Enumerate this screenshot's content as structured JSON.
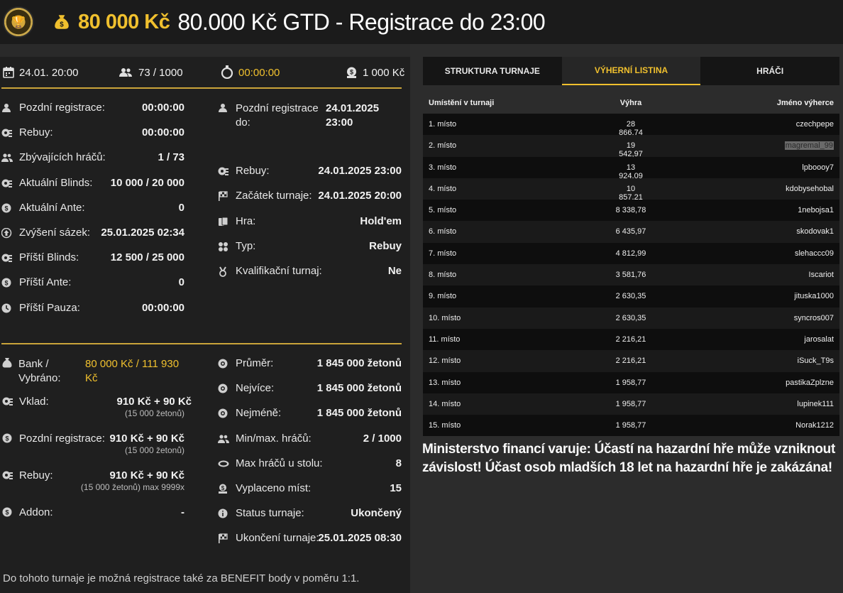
{
  "header": {
    "prize": "80 000 Kč",
    "title": "80.000 Kč GTD - Registrace do 23:00"
  },
  "left_top": {
    "date": "24.01. 20:00",
    "players": "73 / 1000",
    "timer": "00:00:00",
    "buyin": "1 000 Kč"
  },
  "info_left": [
    {
      "icon": "user-icon",
      "label": "Pozdní registrace:",
      "value": "00:00:00"
    },
    {
      "icon": "chips-icon",
      "label": "Rebuy:",
      "value": "00:00:00"
    },
    {
      "icon": "users-icon",
      "label": "Zbývajících hráčů:",
      "value": "1 / 73"
    },
    {
      "icon": "chips-icon",
      "label": "Aktuální Blinds:",
      "value": "10 000 / 20 000"
    },
    {
      "icon": "coin-icon",
      "label": "Aktuální Ante:",
      "value": "0"
    },
    {
      "icon": "arrow-up-icon",
      "label": "Zvýšení sázek:",
      "value": "25.01.2025 02:34"
    },
    {
      "icon": "chips-icon",
      "label": "Příští Blinds:",
      "value": "12 500 / 25 000"
    },
    {
      "icon": "coin-icon",
      "label": "Příští Ante:",
      "value": "0"
    },
    {
      "icon": "clock-icon",
      "label": "Příští Pauza:",
      "value": "00:00:00"
    }
  ],
  "info_right": [
    {
      "icon": "user-icon",
      "label": "Pozdní registrace do:",
      "value": "24.01.2025 23:00"
    },
    {
      "icon": "chips-icon",
      "label": "Rebuy:",
      "value": "24.01.2025 23:00"
    },
    {
      "icon": "flag-icon",
      "label": "Začátek turnaje:",
      "value": "24.01.2025 20:00"
    },
    {
      "icon": "cards-icon",
      "label": "Hra:",
      "value": "Hold'em"
    },
    {
      "icon": "suits-icon",
      "label": "Typ:",
      "value": "Rebuy"
    },
    {
      "icon": "medal-icon",
      "label": "Kvalifikační turnaj:",
      "value": "Ne"
    }
  ],
  "money_left": {
    "bank_label": "Bank / Vybráno:",
    "bank_value": "80 000 Kč / 111 930 Kč",
    "deposit_label": "Vklad:",
    "deposit_value": "910 Kč + 90 Kč",
    "deposit_sub": "(15 000 žetonů)",
    "late_label": "Pozdní registrace:",
    "late_value": "910 Kč + 90 Kč",
    "late_sub": "(15 000 žetonů)",
    "rebuy_label": "Rebuy:",
    "rebuy_value": "910 Kč + 90 Kč",
    "rebuy_sub": "(15 000 žetonů) max 9999x",
    "addon_label": "Addon:",
    "addon_value": "-"
  },
  "money_right": [
    {
      "icon": "chip-icon",
      "label": "Průměr:",
      "value": "1 845 000 žetonů"
    },
    {
      "icon": "chip-icon",
      "label": "Nejvíce:",
      "value": "1 845 000 žetonů"
    },
    {
      "icon": "chip-icon",
      "label": "Nejméně:",
      "value": "1 845 000 žetonů"
    },
    {
      "icon": "users-icon",
      "label": "Min/max. hráčů:",
      "value": "2 / 1000"
    },
    {
      "icon": "table-icon",
      "label": "Max hráčů u stolu:",
      "value": "8"
    },
    {
      "icon": "payout-icon",
      "label": "Vyplaceno míst:",
      "value": "15"
    },
    {
      "icon": "info-icon",
      "label": "Status turnaje:",
      "value": "Ukončený"
    },
    {
      "icon": "flag-icon",
      "label": "Ukončení turnaje:",
      "value": "25.01.2025 08:30"
    }
  ],
  "footer_note": "Do tohoto turnaje je možná registrace také za BENEFIT body v poměru 1:1.",
  "tabs": [
    "STRUKTURA TURNAJE",
    "VÝHERNÍ LISTINA",
    "HRÁČI"
  ],
  "payout_table": {
    "headers": [
      "Umístění v turnaji",
      "Výhra",
      "Jméno výherce"
    ],
    "rows": [
      [
        "1. místo",
        "28 866,74",
        "czechpepe"
      ],
      [
        "2. místo",
        "19 542,97",
        "magremal_99"
      ],
      [
        "3. místo",
        "13 924,09",
        "lpboooy7"
      ],
      [
        "4. místo",
        "10 857,21",
        "kdobysehobal"
      ],
      [
        "5. místo",
        "8 338,78",
        "1nebojsa1"
      ],
      [
        "6. místo",
        "6 435,97",
        "skodovak1"
      ],
      [
        "7. místo",
        "4 812,99",
        "slehaccc09"
      ],
      [
        "8. místo",
        "3 581,76",
        "Iscariot"
      ],
      [
        "9. místo",
        "2 630,35",
        "jituska1000"
      ],
      [
        "10. místo",
        "2 630,35",
        "syncros007"
      ],
      [
        "11. místo",
        "2 216,21",
        "jarosalat"
      ],
      [
        "12. místo",
        "2 216,21",
        "iSuck_T9s"
      ],
      [
        "13. místo",
        "1 958,77",
        "pastikaZplzne"
      ],
      [
        "14. místo",
        "1 958,77",
        "lupinek111"
      ],
      [
        "15. místo",
        "1 958,77",
        "Norak1212"
      ]
    ]
  },
  "warning": "Ministerstvo financí varuje: Účastí na hazardní hře může vzniknout závislost! Účast osob mladších 18 let na hazardní hře je zakázána!"
}
